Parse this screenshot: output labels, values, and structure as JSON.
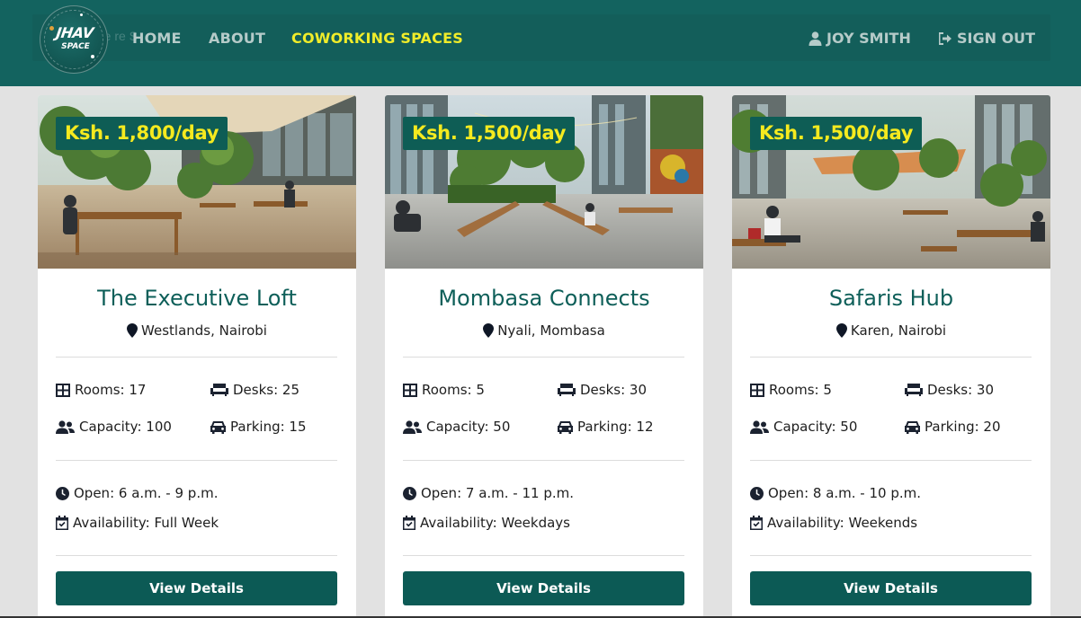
{
  "nav": {
    "logo_text_1": "JHAV",
    "logo_text_2": "SPACE",
    "ghost_text": "me         re S",
    "links": [
      {
        "label": "HOME"
      },
      {
        "label": "ABOUT"
      },
      {
        "label": "COWORKING SPACES"
      }
    ],
    "user_label": "JOY SMITH",
    "signout_label": "SIGN OUT",
    "active_color": "#f0ec2a"
  },
  "spaces": [
    {
      "price": "Ksh. 1,800/day",
      "name": "The Executive Loft",
      "location": "Westlands, Nairobi",
      "rooms": "Rooms: 17",
      "desks": "Desks: 25",
      "capacity": "Capacity: 100",
      "parking": "Parking: 15",
      "open": "Open: 6 a.m. - 9 p.m.",
      "availability": "Availability: Full Week",
      "button": "View Details"
    },
    {
      "price": "Ksh. 1,500/day",
      "name": "Mombasa Connects",
      "location": "Nyali, Mombasa",
      "rooms": "Rooms: 5",
      "desks": "Desks: 30",
      "capacity": "Capacity: 50",
      "parking": "Parking: 12",
      "open": "Open: 7 a.m. - 11 p.m.",
      "availability": "Availability: Weekdays",
      "button": "View Details"
    },
    {
      "price": "Ksh. 1,500/day",
      "name": "Safaris Hub",
      "location": "Karen, Nairobi",
      "rooms": "Rooms: 5",
      "desks": "Desks: 30",
      "capacity": "Capacity: 50",
      "parking": "Parking: 20",
      "open": "Open: 8 a.m. - 10 p.m.",
      "availability": "Availability: Weekends",
      "button": "View Details"
    }
  ],
  "colors": {
    "navbar": "#13635f",
    "brand_dark": "#0c5a55",
    "price_text": "#f5ea1f",
    "title_text": "#0e5f59"
  }
}
